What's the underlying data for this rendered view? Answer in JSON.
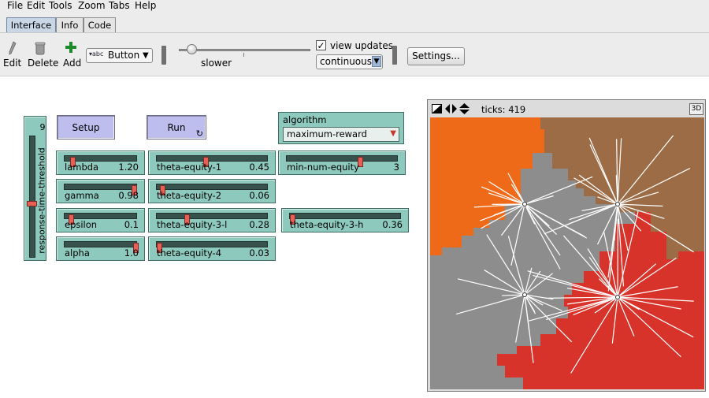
{
  "menu": [
    "File",
    "Edit",
    "Tools",
    "Zoom",
    "Tabs",
    "Help"
  ],
  "tabs": [
    {
      "label": "Interface",
      "active": true
    },
    {
      "label": "Info",
      "active": false
    },
    {
      "label": "Code",
      "active": false
    }
  ],
  "toolbar": {
    "edit_label": "Edit",
    "delete_label": "Delete",
    "add_label": "Add",
    "widget_type": "Button",
    "widget_type_icon_text": "abc",
    "speed_label": "slower",
    "speed_fraction": 0.1,
    "view_updates_label": "view updates",
    "view_updates_checked": true,
    "update_mode": "continuous",
    "settings_label": "Settings..."
  },
  "widgets": {
    "setup_label": "Setup",
    "run_label": "Run",
    "algorithm": {
      "label": "algorithm",
      "value": "maximum-reward"
    },
    "vertical_slider": {
      "label": "response-time-threshold",
      "value": "9",
      "fraction": 0.44
    },
    "sliders": {
      "lambda": {
        "label": "lambda",
        "value": "1.20",
        "fraction": 0.12
      },
      "gamma": {
        "label": "gamma",
        "value": "0.98",
        "fraction": 0.98
      },
      "epsilon": {
        "label": "epsilon",
        "value": "0.1",
        "fraction": 0.1
      },
      "alpha": {
        "label": "alpha",
        "value": "1.0",
        "fraction": 1.0
      },
      "theta_equity_1": {
        "label": "theta-equity-1",
        "value": "0.45",
        "fraction": 0.45
      },
      "theta_equity_2": {
        "label": "theta-equity-2",
        "value": "0.06",
        "fraction": 0.06
      },
      "theta_equity_3_l": {
        "label": "theta-equity-3-l",
        "value": "0.28",
        "fraction": 0.28
      },
      "theta_equity_4": {
        "label": "theta-equity-4",
        "value": "0.03",
        "fraction": 0.03
      },
      "min_num_equity": {
        "label": "min-num-equity",
        "value": "3",
        "fraction": 0.67
      },
      "theta_equity_3_h": {
        "label": "theta-equity-3-h",
        "value": "0.36",
        "fraction": 0.03
      }
    }
  },
  "view": {
    "ticks_label": "ticks: 419",
    "three_d_label": "3D",
    "colors": {
      "orange": "#ee6a18",
      "brown": "#9c6c47",
      "gray": "#8d8d8d",
      "red": "#d8332a",
      "line": "#ffffff"
    }
  }
}
